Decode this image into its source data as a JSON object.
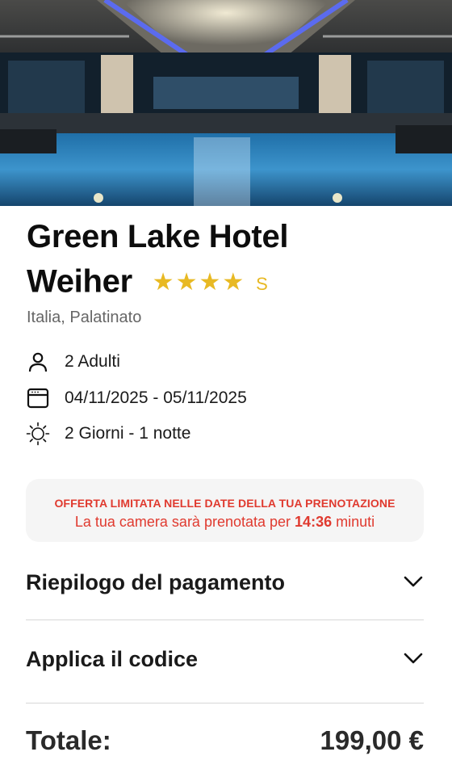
{
  "hotel": {
    "name_line1": "Green Lake Hotel",
    "name_line2": "Weiher",
    "stars": 4,
    "stars_text": "★★★★",
    "stars_suffix": "S",
    "location": "Italia, Palatinato"
  },
  "booking": {
    "guests": "2 Adulti",
    "dates": "04/11/2025 - 05/11/2025",
    "duration": "2 Giorni - 1 notte"
  },
  "offer": {
    "title": "OFFERTA LIMITATA NELLE DATE DELLA TUA PRENOTAZIONE",
    "msg_prefix": "La tua camera sarà prenotata per",
    "timer": "14:36",
    "msg_suffix": "minuti"
  },
  "sections": {
    "payment_summary": "Riepilogo del pagamento",
    "apply_code": "Applica il codice"
  },
  "total": {
    "label": "Totale:",
    "amount": "199,00 €"
  },
  "colors": {
    "accent_star": "#e8b923",
    "offer_red": "#e03a2f",
    "offer_bg": "#f5f5f5"
  },
  "icons": {
    "guests": "person-icon",
    "dates": "calendar-icon",
    "duration": "sun-icon",
    "expand": "chevron-down-icon"
  }
}
